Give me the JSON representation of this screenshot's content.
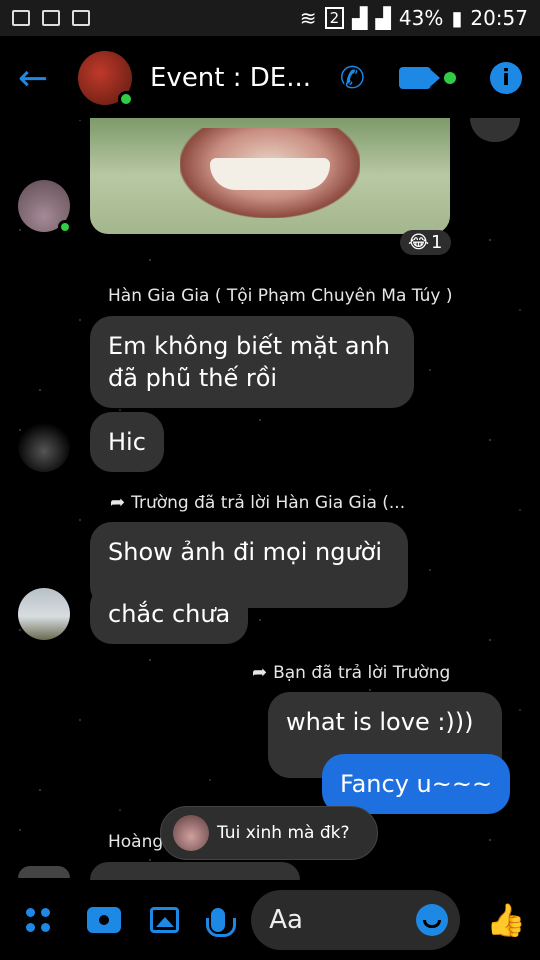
{
  "status_bar": {
    "sim_slot": "2",
    "battery": "43%",
    "time": "20:57"
  },
  "header": {
    "title": "Event : DE...",
    "back_icon": "arrow-left-icon",
    "call_icon": "phone-icon",
    "video_icon": "video-camera-icon",
    "info_icon": "info-icon",
    "accent": "#1e88e5",
    "online_color": "#31cc46"
  },
  "chat": {
    "photo_reaction": {
      "emoji": "😂",
      "count": "1"
    },
    "messages": [
      {
        "sender": "Hàn Gia Gia ( Tội Phạm Chuyên Ma Túy )",
        "lines": [
          "Em không biết mặt anh",
          "đã phũ thế rồi"
        ]
      },
      {
        "text": "Hic"
      },
      {
        "reply_label": "Trường đã trả lời Hàn Gia Gia (...",
        "text": "Show ảnh đi mọi người"
      },
      {
        "text": "chắc chưa"
      },
      {
        "reply_label": "Bạn đã trả lời Trường",
        "text": "what is love :)))",
        "mine_quoted": true
      },
      {
        "text": "Fancy u~~~",
        "mine": true
      },
      {
        "sender": "Hoàng"
      }
    ],
    "preview_text": "Tui xinh mà đk?"
  },
  "composer": {
    "placeholder": "Aa",
    "apps_icon": "apps-grid-icon",
    "camera_icon": "camera-icon",
    "gallery_icon": "image-icon",
    "mic_icon": "microphone-icon",
    "emoji_icon": "emoji-icon",
    "like_icon": "thumbs-up-icon"
  }
}
